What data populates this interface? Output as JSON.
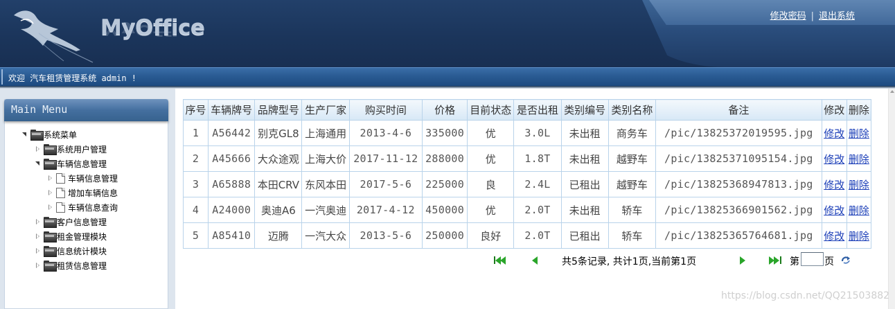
{
  "header": {
    "brand": "MyOffice",
    "links": {
      "change_password": "修改密码",
      "separator": "|",
      "logout": "退出系统"
    }
  },
  "welcome": {
    "text": "欢迎 汽车租赁管理系统 admin !"
  },
  "menu": {
    "title": "Main Menu",
    "items": [
      {
        "label": "系统菜单",
        "level": 0,
        "state": "open",
        "icon": "folder-icon"
      },
      {
        "label": "系统用户管理",
        "level": 1,
        "state": "closed",
        "icon": "folder-icon"
      },
      {
        "label": "车辆信息管理",
        "level": 1,
        "state": "open",
        "icon": "folder-icon"
      },
      {
        "label": "车辆信息管理",
        "level": 2,
        "state": "closed",
        "icon": "page-icon"
      },
      {
        "label": "增加车辆信息",
        "level": 2,
        "state": "closed",
        "icon": "page-icon"
      },
      {
        "label": "车辆信息查询",
        "level": 2,
        "state": "closed",
        "icon": "page-icon"
      },
      {
        "label": "客户信息管理",
        "level": 1,
        "state": "closed",
        "icon": "folder-icon"
      },
      {
        "label": "租金管理模块",
        "level": 1,
        "state": "closed",
        "icon": "folder-icon"
      },
      {
        "label": "信息统计模块",
        "level": 1,
        "state": "closed",
        "icon": "folder-icon"
      },
      {
        "label": "租赁信息管理",
        "level": 1,
        "state": "closed",
        "icon": "folder-icon"
      }
    ]
  },
  "table": {
    "headers": [
      "序号",
      "车辆牌号",
      "品牌型号",
      "生产厂家",
      "购买时间",
      "价格",
      "目前状态",
      "是否出租",
      "类别编号",
      "类别名称",
      "备注",
      "修改",
      "删除"
    ],
    "rows": [
      [
        "1",
        "A56442",
        "别克GL8",
        "上海通用",
        "2013-4-6",
        "335000",
        "优",
        "3.0L",
        "未出租",
        "商务车",
        "/pic/13825372019595.jpg",
        "修改",
        "删除"
      ],
      [
        "2",
        "A45666",
        "大众途观",
        "上海大价",
        "2017-11-12",
        "288000",
        "优",
        "1.8T",
        "未出租",
        "越野车",
        "/pic/13825371095154.jpg",
        "修改",
        "删除"
      ],
      [
        "3",
        "A65888",
        "本田CRV",
        "东风本田",
        "2017-5-6",
        "225000",
        "良",
        "2.4L",
        "已租出",
        "越野车",
        "/pic/13825368947813.jpg",
        "修改",
        "删除"
      ],
      [
        "4",
        "A24000",
        "奥迪A6",
        "一汽奥迪",
        "2017-4-12",
        "450000",
        "优",
        "2.0T",
        "未出租",
        "轿车",
        "/pic/13825366901562.jpg",
        "修改",
        "删除"
      ],
      [
        "5",
        "A85410",
        "迈腾",
        "一汽大众",
        "2013-5-6",
        "250000",
        "良好",
        "2.0T",
        "已租出",
        "轿车",
        "/pic/13825365764681.jpg",
        "修改",
        "删除"
      ]
    ]
  },
  "pager": {
    "summary": "共5条记录, 共计1页,当前第1页",
    "go_prefix": "第",
    "go_suffix": "页",
    "page_value": ""
  },
  "watermark": "https://blog.csdn.net/QQ21503882"
}
